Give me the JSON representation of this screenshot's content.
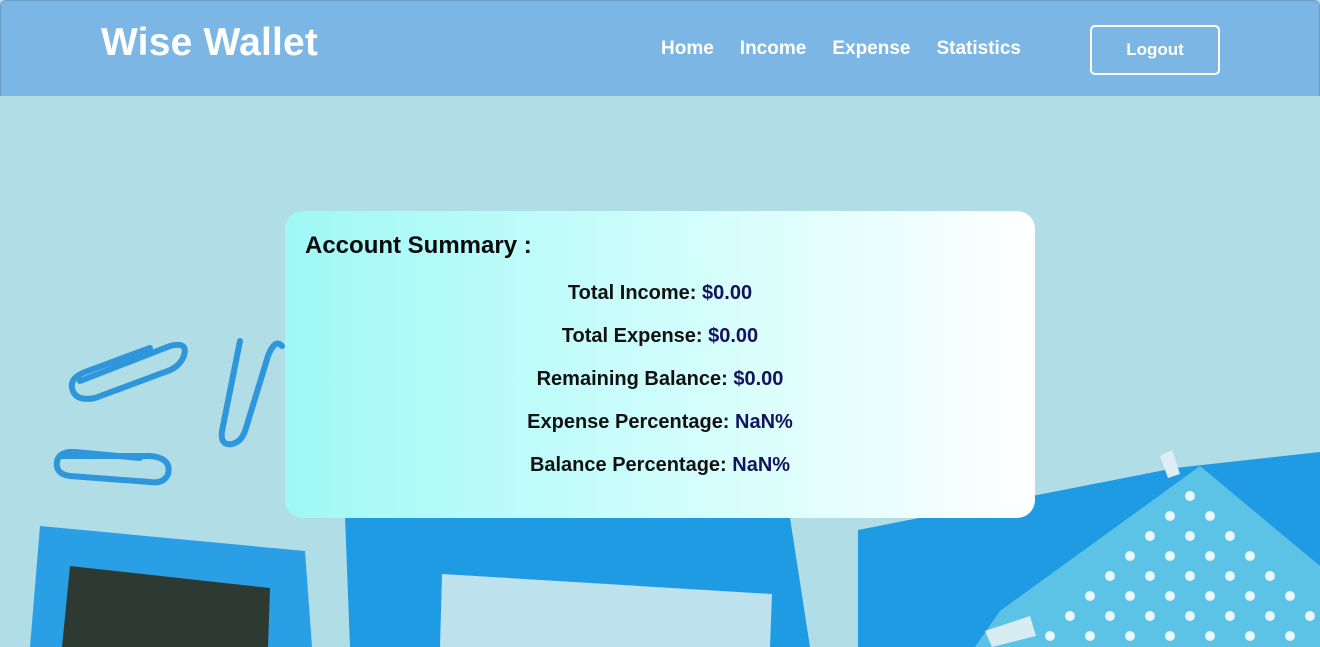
{
  "header": {
    "brand": "Wise Wallet",
    "nav": [
      "Home",
      "Income",
      "Expense",
      "Statistics"
    ],
    "logout_label": "Logout"
  },
  "summary": {
    "title": "Account Summary :",
    "rows": [
      {
        "label": "Total Income: ",
        "value": "$0.00"
      },
      {
        "label": "Total Expense: ",
        "value": "$0.00"
      },
      {
        "label": "Remaining Balance: ",
        "value": "$0.00"
      },
      {
        "label": "Expense Percentage: ",
        "value": "NaN%"
      },
      {
        "label": "Balance Percentage: ",
        "value": "NaN%"
      }
    ]
  },
  "colors": {
    "header_bg": "#7bb6e5",
    "page_bg": "#b1dde6",
    "value_text": "#12125e",
    "accent_blue": "#2e9ee0"
  }
}
